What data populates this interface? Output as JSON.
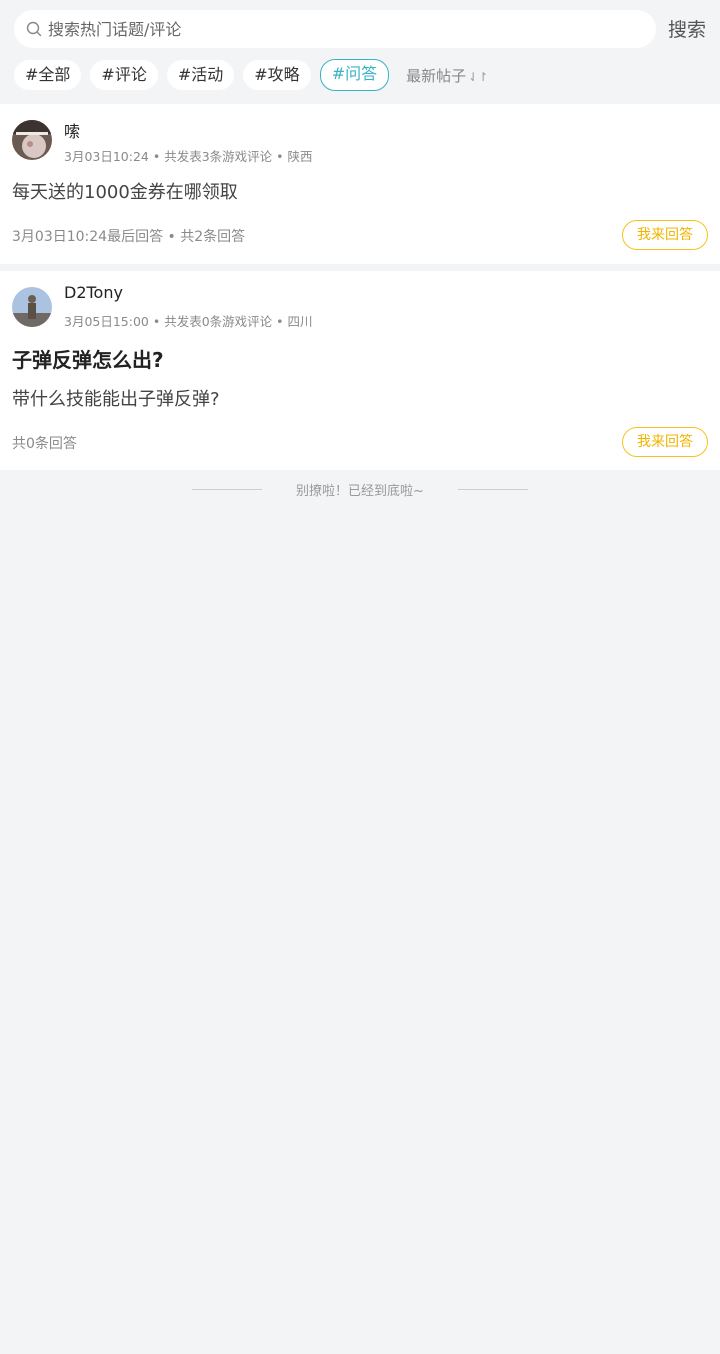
{
  "search": {
    "placeholder": "搜索热门话题/评论",
    "button_label": "搜索"
  },
  "tags": [
    {
      "label": "#全部",
      "active": false
    },
    {
      "label": "#评论",
      "active": false
    },
    {
      "label": "#活动",
      "active": false
    },
    {
      "label": "#攻略",
      "active": false
    },
    {
      "label": "#问答",
      "active": true
    }
  ],
  "sort": {
    "label": "最新帖子",
    "icon": "sort-arrows-icon"
  },
  "posts": [
    {
      "author": "嗦",
      "time": "3月03日10:24",
      "stats": "共发表3条游戏评论",
      "region": "陕西",
      "title": "",
      "body": "每天送的1000金券在哪领取",
      "footer": "3月03日10:24最后回答 • 共2条回答",
      "answer_label": "我来回答"
    },
    {
      "author": "D2Tony",
      "time": "3月05日15:00",
      "stats": "共发表0条游戏评论",
      "region": "四川",
      "title": "子弹反弹怎么出?",
      "body": "带什么技能能出子弹反弹?",
      "footer": "共0条回答",
      "answer_label": "我来回答"
    }
  ],
  "end_text": "别撩啦！已经到底啦~",
  "colors": {
    "accent_teal": "#39b3c4",
    "answer_yellow": "#f0b400",
    "background": "#f3f4f6"
  }
}
